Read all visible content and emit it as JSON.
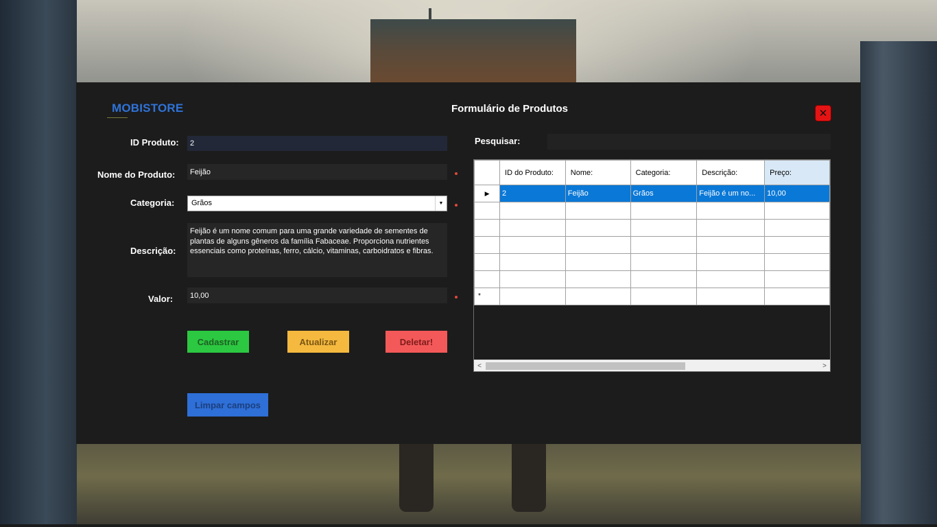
{
  "app": {
    "logo": "MOBISTORE",
    "title": "Formulário de Produtos",
    "close_icon": "close-icon"
  },
  "form": {
    "id_label": "ID Produto:",
    "id_value": "2",
    "name_label": "Nome do Produto:",
    "name_value": "Feijão",
    "category_label": "Categoria:",
    "category_value": "Grãos",
    "description_label": "Descrição:",
    "description_value": "Feijão é um nome comum para uma grande variedade de sementes de plantas de alguns gêneros da família Fabaceae. Proporciona nutrientes essenciais como proteínas, ferro, cálcio, vitaminas, carboidratos e fibras.",
    "value_label": "Valor:",
    "value_value": "10,00",
    "required_color": "#e04a3a"
  },
  "buttons": {
    "cadastrar": "Cadastrar",
    "atualizar": "Atualizar",
    "deletar": "Deletar!",
    "limpar": "Limpar campos"
  },
  "colors": {
    "cadastrar": "#2cc841",
    "atualizar": "#f4b93e",
    "deletar": "#f45959",
    "limpar": "#2e6fd8",
    "selection": "#0a78d7",
    "logo": "#2f73d9"
  },
  "search": {
    "label": "Pesquisar:",
    "value": ""
  },
  "grid": {
    "columns": [
      "ID do Produto:",
      "Nome:",
      "Categoria:",
      "Descrição:",
      "Preço:"
    ],
    "rows": [
      [
        "2",
        "Feijão",
        "Grãos",
        "Feijão é um no...",
        "10,00"
      ]
    ],
    "empty_rows": 5,
    "selected_row_icon": "row-pointer-icon",
    "new_row_icon": "new-row-asterisk-icon"
  }
}
